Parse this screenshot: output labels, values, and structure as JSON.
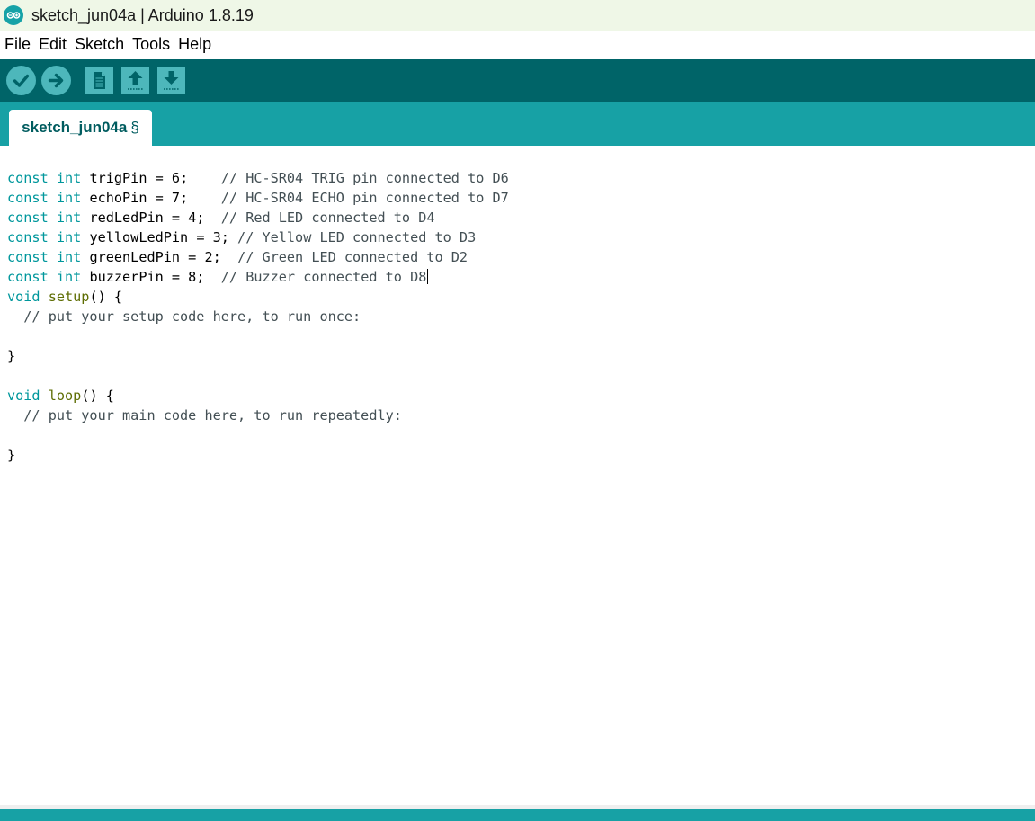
{
  "window": {
    "title": "sketch_jun04a | Arduino 1.8.19",
    "app_icon": "arduino-logo-icon"
  },
  "menu": [
    "File",
    "Edit",
    "Sketch",
    "Tools",
    "Help"
  ],
  "toolbar": {
    "buttons": [
      {
        "name": "verify",
        "icon": "checkmark-icon"
      },
      {
        "name": "upload",
        "icon": "arrow-right-icon"
      },
      {
        "name": "new",
        "icon": "document-icon"
      },
      {
        "name": "open",
        "icon": "arrow-up-icon"
      },
      {
        "name": "save",
        "icon": "arrow-down-icon"
      }
    ]
  },
  "tabs": [
    {
      "label": "sketch_jun04a",
      "marker": "§"
    }
  ],
  "colors": {
    "toolbar_bg": "#006468",
    "tab_strip_bg": "#17a1a5",
    "keyword": "#00979c",
    "function": "#5e6d03",
    "comment": "#434f54"
  },
  "code_lines": [
    [
      {
        "t": "const",
        "c": "kw"
      },
      {
        "t": " ",
        "c": "pl"
      },
      {
        "t": "int",
        "c": "kw"
      },
      {
        "t": " trigPin = 6;    ",
        "c": "pl"
      },
      {
        "t": "// HC-SR04 TRIG pin connected to D6",
        "c": "cm"
      }
    ],
    [
      {
        "t": "const",
        "c": "kw"
      },
      {
        "t": " ",
        "c": "pl"
      },
      {
        "t": "int",
        "c": "kw"
      },
      {
        "t": " echoPin = 7;    ",
        "c": "pl"
      },
      {
        "t": "// HC-SR04 ECHO pin connected to D7",
        "c": "cm"
      }
    ],
    [
      {
        "t": "const",
        "c": "kw"
      },
      {
        "t": " ",
        "c": "pl"
      },
      {
        "t": "int",
        "c": "kw"
      },
      {
        "t": " redLedPin = 4;  ",
        "c": "pl"
      },
      {
        "t": "// Red LED connected to D4",
        "c": "cm"
      }
    ],
    [
      {
        "t": "const",
        "c": "kw"
      },
      {
        "t": " ",
        "c": "pl"
      },
      {
        "t": "int",
        "c": "kw"
      },
      {
        "t": " yellowLedPin = 3; ",
        "c": "pl"
      },
      {
        "t": "// Yellow LED connected to D3",
        "c": "cm"
      }
    ],
    [
      {
        "t": "const",
        "c": "kw"
      },
      {
        "t": " ",
        "c": "pl"
      },
      {
        "t": "int",
        "c": "kw"
      },
      {
        "t": " greenLedPin = 2;  ",
        "c": "pl"
      },
      {
        "t": "// Green LED connected to D2",
        "c": "cm"
      }
    ],
    [
      {
        "t": "const",
        "c": "kw"
      },
      {
        "t": " ",
        "c": "pl"
      },
      {
        "t": "int",
        "c": "kw"
      },
      {
        "t": " buzzerPin = 8;  ",
        "c": "pl"
      },
      {
        "t": "// Buzzer connected to D8",
        "c": "cm"
      },
      {
        "t": "",
        "c": "caret"
      }
    ],
    [
      {
        "t": "void",
        "c": "kw"
      },
      {
        "t": " ",
        "c": "pl"
      },
      {
        "t": "setup",
        "c": "fn"
      },
      {
        "t": "() {",
        "c": "pl"
      }
    ],
    [
      {
        "t": "  // put your setup code here, to run once:",
        "c": "cm"
      }
    ],
    [
      {
        "t": "",
        "c": "pl"
      }
    ],
    [
      {
        "t": "}",
        "c": "pl"
      }
    ],
    [
      {
        "t": "",
        "c": "pl"
      }
    ],
    [
      {
        "t": "void",
        "c": "kw"
      },
      {
        "t": " ",
        "c": "pl"
      },
      {
        "t": "loop",
        "c": "fn"
      },
      {
        "t": "() {",
        "c": "pl"
      }
    ],
    [
      {
        "t": "  // put your main code here, to run repeatedly:",
        "c": "cm"
      }
    ],
    [
      {
        "t": "",
        "c": "pl"
      }
    ],
    [
      {
        "t": "}",
        "c": "pl"
      }
    ]
  ]
}
